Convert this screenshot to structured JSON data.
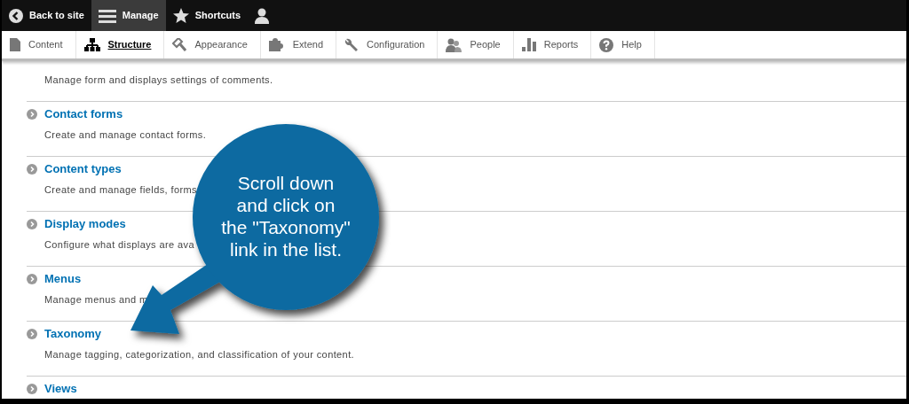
{
  "toolbar": {
    "items": [
      {
        "label": "Back to site",
        "kind": "back",
        "selected": false
      },
      {
        "label": "Manage",
        "kind": "menu",
        "selected": true
      },
      {
        "label": "Shortcuts",
        "kind": "star",
        "selected": false
      },
      {
        "kind": "user",
        "selected": false
      }
    ]
  },
  "tabs": [
    {
      "label": "Content",
      "selected": false
    },
    {
      "label": "Structure",
      "selected": true
    },
    {
      "label": "Appearance",
      "selected": false
    },
    {
      "label": "Extend",
      "selected": false
    },
    {
      "label": "Configuration",
      "selected": false
    },
    {
      "label": "People",
      "selected": false
    },
    {
      "label": "Reports",
      "selected": false
    },
    {
      "label": "Help",
      "selected": false
    }
  ],
  "items": [
    {
      "description": "Manage form and displays settings of comments."
    },
    {
      "title": "Contact forms",
      "description": "Create and manage contact forms."
    },
    {
      "title": "Content types",
      "description": "Create and manage fields, forms"
    },
    {
      "title": "Display modes",
      "description": "Configure what displays are ava"
    },
    {
      "title": "Menus",
      "description": "Manage menus and m"
    },
    {
      "title": "Taxonomy",
      "description": "Manage tagging, categorization, and classification of your content."
    },
    {
      "title": "Views"
    }
  ],
  "callout": {
    "text": "Scroll down\nand click on\nthe \"Taxonomy\"\nlink in the list."
  }
}
